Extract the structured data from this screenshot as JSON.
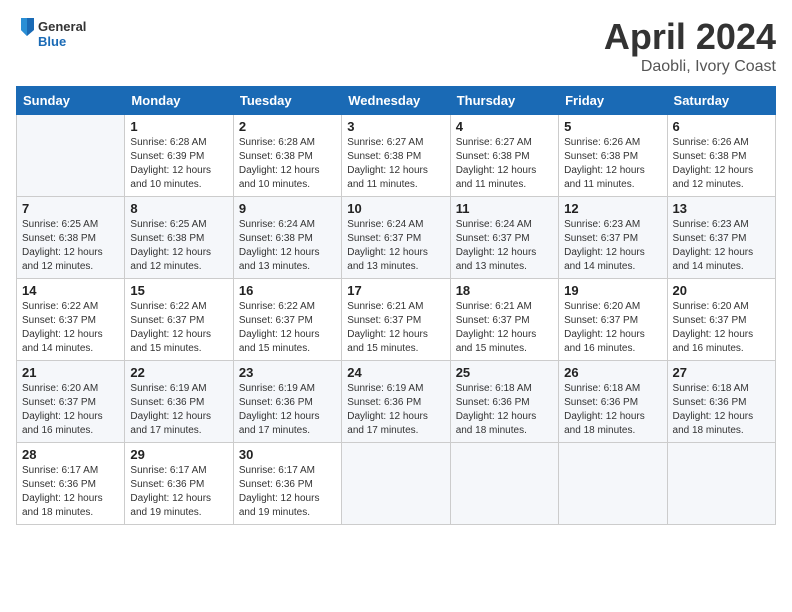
{
  "header": {
    "logo_general": "General",
    "logo_blue": "Blue",
    "month_title": "April 2024",
    "location": "Daobli, Ivory Coast"
  },
  "weekdays": [
    "Sunday",
    "Monday",
    "Tuesday",
    "Wednesday",
    "Thursday",
    "Friday",
    "Saturday"
  ],
  "weeks": [
    [
      {
        "day": "",
        "sunrise": "",
        "sunset": "",
        "daylight": ""
      },
      {
        "day": "1",
        "sunrise": "Sunrise: 6:28 AM",
        "sunset": "Sunset: 6:39 PM",
        "daylight": "Daylight: 12 hours and 10 minutes."
      },
      {
        "day": "2",
        "sunrise": "Sunrise: 6:28 AM",
        "sunset": "Sunset: 6:38 PM",
        "daylight": "Daylight: 12 hours and 10 minutes."
      },
      {
        "day": "3",
        "sunrise": "Sunrise: 6:27 AM",
        "sunset": "Sunset: 6:38 PM",
        "daylight": "Daylight: 12 hours and 11 minutes."
      },
      {
        "day": "4",
        "sunrise": "Sunrise: 6:27 AM",
        "sunset": "Sunset: 6:38 PM",
        "daylight": "Daylight: 12 hours and 11 minutes."
      },
      {
        "day": "5",
        "sunrise": "Sunrise: 6:26 AM",
        "sunset": "Sunset: 6:38 PM",
        "daylight": "Daylight: 12 hours and 11 minutes."
      },
      {
        "day": "6",
        "sunrise": "Sunrise: 6:26 AM",
        "sunset": "Sunset: 6:38 PM",
        "daylight": "Daylight: 12 hours and 12 minutes."
      }
    ],
    [
      {
        "day": "7",
        "sunrise": "Sunrise: 6:25 AM",
        "sunset": "Sunset: 6:38 PM",
        "daylight": "Daylight: 12 hours and 12 minutes."
      },
      {
        "day": "8",
        "sunrise": "Sunrise: 6:25 AM",
        "sunset": "Sunset: 6:38 PM",
        "daylight": "Daylight: 12 hours and 12 minutes."
      },
      {
        "day": "9",
        "sunrise": "Sunrise: 6:24 AM",
        "sunset": "Sunset: 6:38 PM",
        "daylight": "Daylight: 12 hours and 13 minutes."
      },
      {
        "day": "10",
        "sunrise": "Sunrise: 6:24 AM",
        "sunset": "Sunset: 6:37 PM",
        "daylight": "Daylight: 12 hours and 13 minutes."
      },
      {
        "day": "11",
        "sunrise": "Sunrise: 6:24 AM",
        "sunset": "Sunset: 6:37 PM",
        "daylight": "Daylight: 12 hours and 13 minutes."
      },
      {
        "day": "12",
        "sunrise": "Sunrise: 6:23 AM",
        "sunset": "Sunset: 6:37 PM",
        "daylight": "Daylight: 12 hours and 14 minutes."
      },
      {
        "day": "13",
        "sunrise": "Sunrise: 6:23 AM",
        "sunset": "Sunset: 6:37 PM",
        "daylight": "Daylight: 12 hours and 14 minutes."
      }
    ],
    [
      {
        "day": "14",
        "sunrise": "Sunrise: 6:22 AM",
        "sunset": "Sunset: 6:37 PM",
        "daylight": "Daylight: 12 hours and 14 minutes."
      },
      {
        "day": "15",
        "sunrise": "Sunrise: 6:22 AM",
        "sunset": "Sunset: 6:37 PM",
        "daylight": "Daylight: 12 hours and 15 minutes."
      },
      {
        "day": "16",
        "sunrise": "Sunrise: 6:22 AM",
        "sunset": "Sunset: 6:37 PM",
        "daylight": "Daylight: 12 hours and 15 minutes."
      },
      {
        "day": "17",
        "sunrise": "Sunrise: 6:21 AM",
        "sunset": "Sunset: 6:37 PM",
        "daylight": "Daylight: 12 hours and 15 minutes."
      },
      {
        "day": "18",
        "sunrise": "Sunrise: 6:21 AM",
        "sunset": "Sunset: 6:37 PM",
        "daylight": "Daylight: 12 hours and 15 minutes."
      },
      {
        "day": "19",
        "sunrise": "Sunrise: 6:20 AM",
        "sunset": "Sunset: 6:37 PM",
        "daylight": "Daylight: 12 hours and 16 minutes."
      },
      {
        "day": "20",
        "sunrise": "Sunrise: 6:20 AM",
        "sunset": "Sunset: 6:37 PM",
        "daylight": "Daylight: 12 hours and 16 minutes."
      }
    ],
    [
      {
        "day": "21",
        "sunrise": "Sunrise: 6:20 AM",
        "sunset": "Sunset: 6:37 PM",
        "daylight": "Daylight: 12 hours and 16 minutes."
      },
      {
        "day": "22",
        "sunrise": "Sunrise: 6:19 AM",
        "sunset": "Sunset: 6:36 PM",
        "daylight": "Daylight: 12 hours and 17 minutes."
      },
      {
        "day": "23",
        "sunrise": "Sunrise: 6:19 AM",
        "sunset": "Sunset: 6:36 PM",
        "daylight": "Daylight: 12 hours and 17 minutes."
      },
      {
        "day": "24",
        "sunrise": "Sunrise: 6:19 AM",
        "sunset": "Sunset: 6:36 PM",
        "daylight": "Daylight: 12 hours and 17 minutes."
      },
      {
        "day": "25",
        "sunrise": "Sunrise: 6:18 AM",
        "sunset": "Sunset: 6:36 PM",
        "daylight": "Daylight: 12 hours and 18 minutes."
      },
      {
        "day": "26",
        "sunrise": "Sunrise: 6:18 AM",
        "sunset": "Sunset: 6:36 PM",
        "daylight": "Daylight: 12 hours and 18 minutes."
      },
      {
        "day": "27",
        "sunrise": "Sunrise: 6:18 AM",
        "sunset": "Sunset: 6:36 PM",
        "daylight": "Daylight: 12 hours and 18 minutes."
      }
    ],
    [
      {
        "day": "28",
        "sunrise": "Sunrise: 6:17 AM",
        "sunset": "Sunset: 6:36 PM",
        "daylight": "Daylight: 12 hours and 18 minutes."
      },
      {
        "day": "29",
        "sunrise": "Sunrise: 6:17 AM",
        "sunset": "Sunset: 6:36 PM",
        "daylight": "Daylight: 12 hours and 19 minutes."
      },
      {
        "day": "30",
        "sunrise": "Sunrise: 6:17 AM",
        "sunset": "Sunset: 6:36 PM",
        "daylight": "Daylight: 12 hours and 19 minutes."
      },
      {
        "day": "",
        "sunrise": "",
        "sunset": "",
        "daylight": ""
      },
      {
        "day": "",
        "sunrise": "",
        "sunset": "",
        "daylight": ""
      },
      {
        "day": "",
        "sunrise": "",
        "sunset": "",
        "daylight": ""
      },
      {
        "day": "",
        "sunrise": "",
        "sunset": "",
        "daylight": ""
      }
    ]
  ]
}
